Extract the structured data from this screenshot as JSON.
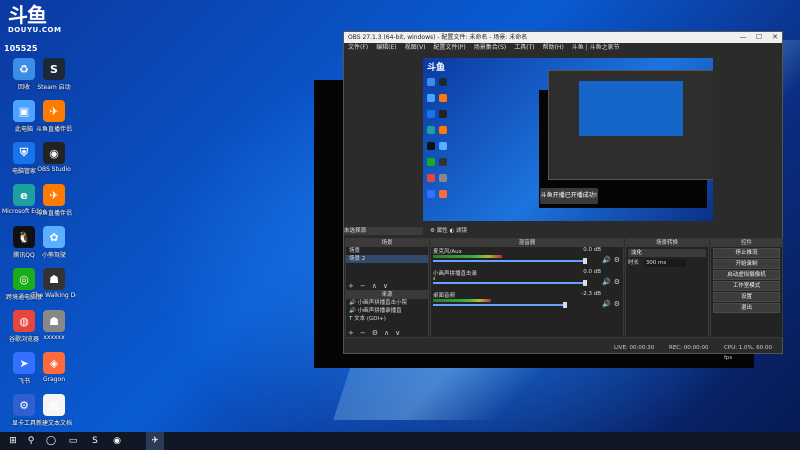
{
  "overlay": {
    "brand_zh": "斗鱼",
    "brand_en": "DOUYU.COM",
    "room_id": "105525"
  },
  "desktop_icons": [
    {
      "label": "回收",
      "icon": "recycle-bin-icon",
      "color": "#3a8ee6",
      "glyph": "♻"
    },
    {
      "label": "Steam 启动",
      "icon": "steam-icon",
      "color": "#1b2838",
      "glyph": "S"
    },
    {
      "label": "此电脑",
      "icon": "computer-icon",
      "color": "#4da3ff",
      "glyph": "▣"
    },
    {
      "label": "斗鱼直播伴侣",
      "icon": "douyu-icon",
      "color": "#ff7a00",
      "glyph": "✈"
    },
    {
      "label": "电脑管家",
      "icon": "shield-icon",
      "color": "#1a73e8",
      "glyph": "⛨"
    },
    {
      "label": "OBS Studio",
      "icon": "obs-icon",
      "color": "#222222",
      "glyph": "◉"
    },
    {
      "label": "Microsoft Edge",
      "icon": "edge-icon",
      "color": "#1da1a0",
      "glyph": "e"
    },
    {
      "label": "斗鱼直播伴侣",
      "icon": "douyu-icon",
      "color": "#ff7a00",
      "glyph": "✈"
    },
    {
      "label": "腾讯QQ",
      "icon": "qq-icon",
      "color": "#111111",
      "glyph": "🐧"
    },
    {
      "label": "小熊驾驶",
      "icon": "app-icon",
      "color": "#5ab0ff",
      "glyph": "✿"
    },
    {
      "label": "跨境通电脑版",
      "icon": "wechat-icon",
      "color": "#1aad19",
      "glyph": "◎"
    },
    {
      "label": "The Walking Dead",
      "icon": "game-icon",
      "color": "#333333",
      "glyph": "☗"
    },
    {
      "label": "谷歌浏览器",
      "icon": "chrome-icon",
      "color": "#e8453c",
      "glyph": "◍"
    },
    {
      "label": "xxxxxx",
      "icon": "game-icon",
      "color": "#888888",
      "glyph": "☗"
    },
    {
      "label": "飞书",
      "icon": "feishu-icon",
      "color": "#3370ff",
      "glyph": "➤"
    },
    {
      "label": "Gragon",
      "icon": "map-pin-icon",
      "color": "#ff6a3d",
      "glyph": "◈"
    },
    {
      "label": "显卡工具",
      "icon": "tool-icon",
      "color": "#3060d0",
      "glyph": "⚙"
    },
    {
      "label": "新建文本文档",
      "icon": "document-icon",
      "color": "#f4f4f4",
      "glyph": "▤"
    }
  ],
  "obs": {
    "title": "OBS 27.1.3 (64-bit, windows) - 配置文件: 未命名 - 场景: 未命名",
    "menu": [
      "文件(F)",
      "编辑(E)",
      "视图(V)",
      "配置文件(P)",
      "场景集合(S)",
      "工具(T)",
      "帮助(H)",
      "斗鱼 | 斗鱼之家节"
    ],
    "toast": "斗鱼开播已开播成功!",
    "preview_label": "未选择源",
    "props_btn": "属性",
    "filters_btn": "滤镜",
    "scenes_header": "场景",
    "scenes": [
      "场景",
      "场景 2"
    ],
    "sources_header": "来源",
    "sources": [
      "小画声拼播直击小院",
      "小画声拼播录播直",
      "文本 (GDI+)"
    ],
    "mixer_header": "混音器",
    "mixer": [
      {
        "name": "麦克风/Aux",
        "db": "0.0 dB",
        "level": 0.42,
        "volume": 0.92
      },
      {
        "name": "小画声拼播直击录",
        "db": "0.0 dB",
        "level": 0.0,
        "volume": 0.92
      },
      {
        "name": "桌面音频",
        "db": "-2.3 dB",
        "level": 0.35,
        "volume": 0.8
      }
    ],
    "transitions_header": "场景转换",
    "transition_type": "淡化",
    "duration_label": "时长",
    "duration_value": "300 ms",
    "controls_header": "控件",
    "controls": [
      "停止推流",
      "开始录制",
      "启动虚拟摄像机",
      "工作室模式",
      "设置",
      "退出"
    ],
    "status": {
      "live": "LIVE: 00:00:30",
      "rec": "REC: 00:00:00",
      "cpu": "CPU: 1.0%, 60.00 fps"
    }
  },
  "taskbar": {
    "items": [
      {
        "name": "start-button",
        "glyph": "⊞"
      },
      {
        "name": "search-icon",
        "glyph": "⚲"
      },
      {
        "name": "task-view-icon",
        "glyph": "◯"
      },
      {
        "name": "file-explorer-icon",
        "glyph": "▭"
      },
      {
        "name": "steam-taskbar-icon",
        "glyph": "S"
      },
      {
        "name": "obs-taskbar-icon",
        "glyph": "◉"
      },
      {
        "name": "douyu-taskbar-icon",
        "glyph": "✈"
      }
    ]
  }
}
